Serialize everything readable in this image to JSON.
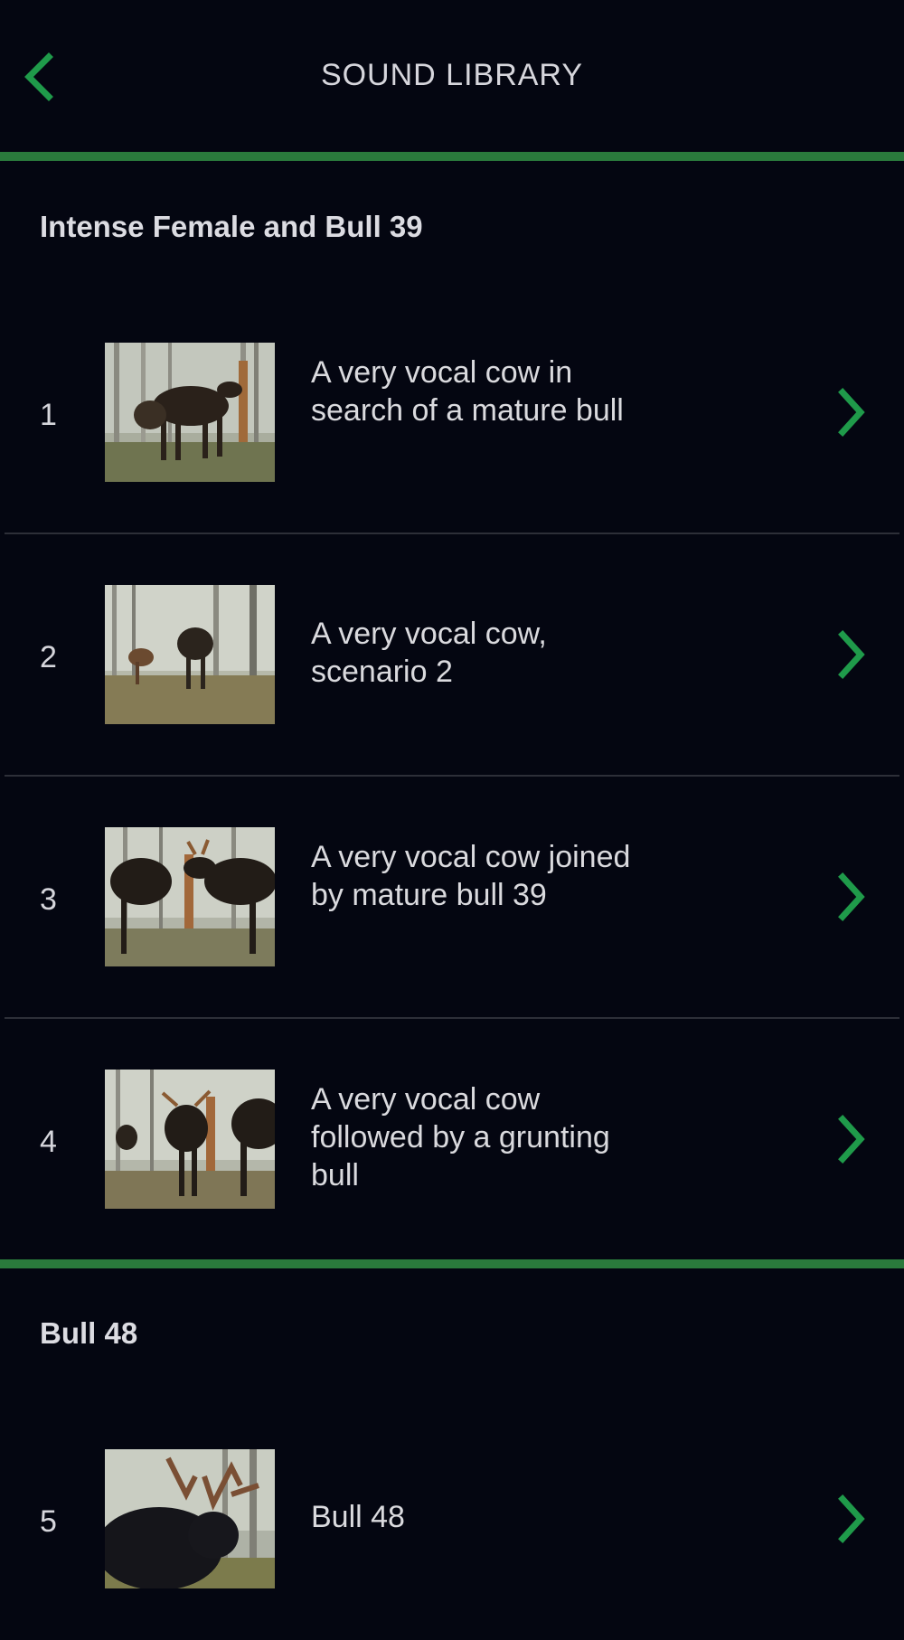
{
  "header": {
    "title": "SOUND LIBRARY",
    "back_icon": "chevron-left-icon"
  },
  "colors": {
    "background": "#040611",
    "accent_green": "#1f9a4a",
    "divider_green": "#2a7a3c",
    "text": "#d9d9de"
  },
  "sections": [
    {
      "title": "Intense Female and Bull 39",
      "items": [
        {
          "number": "1",
          "text": "A very vocal cow in search of a mature bull",
          "thumbnail": "moose-cow-forest-photo"
        },
        {
          "number": "2",
          "text": "A very vocal cow, scenario 2",
          "thumbnail": "moose-forest-photo"
        },
        {
          "number": "3",
          "text": "A very vocal cow joined by mature bull 39",
          "thumbnail": "moose-cow-bull-photo"
        },
        {
          "number": "4",
          "text": "A very vocal cow followed by a grunting bull",
          "thumbnail": "moose-bull-photo"
        }
      ]
    },
    {
      "title": "Bull 48",
      "items": [
        {
          "number": "5",
          "text": "Bull 48",
          "thumbnail": "bull-moose-antlers-photo"
        }
      ]
    }
  ]
}
